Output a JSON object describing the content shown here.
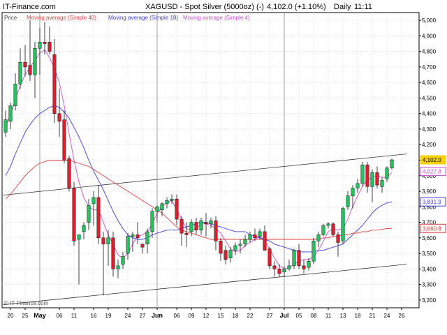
{
  "header": {
    "site": "IT-Finance.com",
    "title": "XAGUSD - Spot Silver (5000oz) (-)",
    "last": "4,102.0 (+1.10%)",
    "period": "Daily",
    "time": "11:11"
  },
  "watermark": "© IT-Finance.com",
  "colors": {
    "up": "#22c55e",
    "down": "#e11d2e",
    "ma40": "#e04040",
    "ma18": "#3b3bdc",
    "ma4": "#d04bd0",
    "trend": "#333333",
    "grid": "#c8c8c8",
    "last_box": "#f5d200",
    "border": "#000000"
  },
  "chart_data": {
    "type": "candlestick",
    "title": "XAGUSD - Spot Silver (5000oz) (-)",
    "legend": [
      {
        "key": "price",
        "label": "Price"
      },
      {
        "key": "ma40",
        "label": "Moving average (Simple 40)"
      },
      {
        "key": "ma18",
        "label": "Moving average (Simple 18)"
      },
      {
        "key": "ma4",
        "label": "Moving average (Simple 4)"
      }
    ],
    "ylim": [
      3150,
      5050
    ],
    "y_ticks": [
      3200,
      3300,
      3400,
      3500,
      3600,
      3700,
      3800,
      3900,
      4000,
      4100,
      4200,
      4300,
      4400,
      4500,
      4600,
      4700,
      4800,
      4900,
      5000
    ],
    "y_tick_labels": [
      "3,200",
      "3,300",
      "3,400",
      "3,500",
      "3,600",
      "3,700",
      "3,800",
      "3,900",
      "4,000",
      "4,100",
      "4,200",
      "4,300",
      "4,400",
      "4,500",
      "4,600",
      "4,700",
      "4,800",
      "4,900",
      "5,000"
    ],
    "x_labels": [
      {
        "i": 1,
        "text": "20"
      },
      {
        "i": 4,
        "text": "25"
      },
      {
        "i": 7,
        "text": "May"
      },
      {
        "i": 11,
        "text": "06"
      },
      {
        "i": 14,
        "text": "11"
      },
      {
        "i": 18,
        "text": "16"
      },
      {
        "i": 21,
        "text": "19"
      },
      {
        "i": 25,
        "text": "24"
      },
      {
        "i": 28,
        "text": "27"
      },
      {
        "i": 31,
        "text": "Jun"
      },
      {
        "i": 35,
        "text": "06"
      },
      {
        "i": 38,
        "text": "09"
      },
      {
        "i": 41,
        "text": "12"
      },
      {
        "i": 44,
        "text": "15"
      },
      {
        "i": 47,
        "text": "18"
      },
      {
        "i": 50,
        "text": "22"
      },
      {
        "i": 54,
        "text": "27"
      },
      {
        "i": 57,
        "text": "Jul"
      },
      {
        "i": 60,
        "text": "05"
      },
      {
        "i": 63,
        "text": "08"
      },
      {
        "i": 66,
        "text": "11"
      },
      {
        "i": 69,
        "text": "13"
      },
      {
        "i": 72,
        "text": "18"
      },
      {
        "i": 75,
        "text": "21"
      },
      {
        "i": 78,
        "text": "24"
      },
      {
        "i": 81,
        "text": "26"
      }
    ],
    "month_separators": [
      7,
      31,
      57
    ],
    "candles": [
      {
        "o": 4280,
        "h": 4420,
        "l": 4250,
        "c": 4360
      },
      {
        "o": 4350,
        "h": 4470,
        "l": 4300,
        "c": 4450
      },
      {
        "o": 4450,
        "h": 4660,
        "l": 4420,
        "c": 4590
      },
      {
        "o": 4590,
        "h": 4820,
        "l": 4560,
        "c": 4730
      },
      {
        "o": 4730,
        "h": 4840,
        "l": 4640,
        "c": 4700
      },
      {
        "o": 4710,
        "h": 5000,
        "l": 4610,
        "c": 4650
      },
      {
        "o": 4650,
        "h": 4860,
        "l": 4500,
        "c": 4820
      },
      {
        "o": 4820,
        "h": 4950,
        "l": 4650,
        "c": 4860
      },
      {
        "o": 4860,
        "h": 4990,
        "l": 4780,
        "c": 4850
      },
      {
        "o": 4860,
        "h": 4960,
        "l": 4780,
        "c": 4800
      },
      {
        "o": 4780,
        "h": 4880,
        "l": 4340,
        "c": 4400
      },
      {
        "o": 4400,
        "h": 4560,
        "l": 4250,
        "c": 4350
      },
      {
        "o": 4360,
        "h": 4420,
        "l": 4080,
        "c": 4100
      },
      {
        "o": 4110,
        "h": 4130,
        "l": 3900,
        "c": 3920
      },
      {
        "o": 3920,
        "h": 3960,
        "l": 3550,
        "c": 3580
      },
      {
        "o": 3590,
        "h": 3620,
        "l": 3300,
        "c": 3620
      },
      {
        "o": 3640,
        "h": 3700,
        "l": 3590,
        "c": 3680
      },
      {
        "o": 3700,
        "h": 3850,
        "l": 3650,
        "c": 3810
      },
      {
        "o": 3820,
        "h": 3900,
        "l": 3680,
        "c": 3860
      },
      {
        "o": 3860,
        "h": 3940,
        "l": 3560,
        "c": 3600
      },
      {
        "o": 3600,
        "h": 3640,
        "l": 3230,
        "c": 3560
      },
      {
        "o": 3560,
        "h": 3650,
        "l": 3420,
        "c": 3600
      },
      {
        "o": 3600,
        "h": 3640,
        "l": 3350,
        "c": 3400
      },
      {
        "o": 3400,
        "h": 3460,
        "l": 3340,
        "c": 3420
      },
      {
        "o": 3430,
        "h": 3510,
        "l": 3400,
        "c": 3480
      },
      {
        "o": 3500,
        "h": 3630,
        "l": 3460,
        "c": 3610
      },
      {
        "o": 3610,
        "h": 3640,
        "l": 3510,
        "c": 3620
      },
      {
        "o": 3620,
        "h": 3700,
        "l": 3560,
        "c": 3600
      },
      {
        "o": 3560,
        "h": 3560,
        "l": 3500,
        "c": 3540
      },
      {
        "o": 3560,
        "h": 3660,
        "l": 3500,
        "c": 3640
      },
      {
        "o": 3640,
        "h": 3790,
        "l": 3600,
        "c": 3770
      },
      {
        "o": 3770,
        "h": 3810,
        "l": 3700,
        "c": 3800
      },
      {
        "o": 3780,
        "h": 3830,
        "l": 3740,
        "c": 3820
      },
      {
        "o": 3820,
        "h": 3860,
        "l": 3790,
        "c": 3840
      },
      {
        "o": 3840,
        "h": 3880,
        "l": 3820,
        "c": 3850
      },
      {
        "o": 3850,
        "h": 3880,
        "l": 3680,
        "c": 3720
      },
      {
        "o": 3720,
        "h": 3740,
        "l": 3550,
        "c": 3630
      },
      {
        "o": 3630,
        "h": 3700,
        "l": 3540,
        "c": 3620
      },
      {
        "o": 3640,
        "h": 3720,
        "l": 3610,
        "c": 3700
      },
      {
        "o": 3700,
        "h": 3730,
        "l": 3620,
        "c": 3650
      },
      {
        "o": 3650,
        "h": 3730,
        "l": 3620,
        "c": 3710
      },
      {
        "o": 3700,
        "h": 3760,
        "l": 3610,
        "c": 3690
      },
      {
        "o": 3690,
        "h": 3730,
        "l": 3660,
        "c": 3710
      },
      {
        "o": 3710,
        "h": 3740,
        "l": 3520,
        "c": 3580
      },
      {
        "o": 3580,
        "h": 3600,
        "l": 3450,
        "c": 3500
      },
      {
        "o": 3520,
        "h": 3550,
        "l": 3430,
        "c": 3460
      },
      {
        "o": 3470,
        "h": 3540,
        "l": 3440,
        "c": 3520
      },
      {
        "o": 3520,
        "h": 3570,
        "l": 3490,
        "c": 3550
      },
      {
        "o": 3550,
        "h": 3590,
        "l": 3500,
        "c": 3560
      },
      {
        "o": 3560,
        "h": 3620,
        "l": 3540,
        "c": 3590
      },
      {
        "o": 3590,
        "h": 3640,
        "l": 3570,
        "c": 3620
      },
      {
        "o": 3620,
        "h": 3660,
        "l": 3580,
        "c": 3600
      },
      {
        "o": 3610,
        "h": 3660,
        "l": 3590,
        "c": 3640
      },
      {
        "o": 3640,
        "h": 3680,
        "l": 3520,
        "c": 3520
      },
      {
        "o": 3530,
        "h": 3540,
        "l": 3400,
        "c": 3420
      },
      {
        "o": 3420,
        "h": 3450,
        "l": 3350,
        "c": 3400
      },
      {
        "o": 3400,
        "h": 3430,
        "l": 3350,
        "c": 3370
      },
      {
        "o": 3380,
        "h": 3420,
        "l": 3350,
        "c": 3400
      },
      {
        "o": 3400,
        "h": 3460,
        "l": 3390,
        "c": 3420
      },
      {
        "o": 3420,
        "h": 3530,
        "l": 3400,
        "c": 3520
      },
      {
        "o": 3520,
        "h": 3560,
        "l": 3400,
        "c": 3420
      },
      {
        "o": 3420,
        "h": 3460,
        "l": 3370,
        "c": 3400
      },
      {
        "o": 3410,
        "h": 3470,
        "l": 3390,
        "c": 3450
      },
      {
        "o": 3450,
        "h": 3600,
        "l": 3430,
        "c": 3580
      },
      {
        "o": 3580,
        "h": 3640,
        "l": 3540,
        "c": 3620
      },
      {
        "o": 3620,
        "h": 3690,
        "l": 3610,
        "c": 3680
      },
      {
        "o": 3680,
        "h": 3700,
        "l": 3660,
        "c": 3690
      },
      {
        "o": 3690,
        "h": 3700,
        "l": 3610,
        "c": 3620
      },
      {
        "o": 3620,
        "h": 3640,
        "l": 3480,
        "c": 3570
      },
      {
        "o": 3580,
        "h": 3800,
        "l": 3560,
        "c": 3790
      },
      {
        "o": 3800,
        "h": 3900,
        "l": 3780,
        "c": 3870
      },
      {
        "o": 3870,
        "h": 3940,
        "l": 3790,
        "c": 3920
      },
      {
        "o": 3920,
        "h": 3980,
        "l": 3890,
        "c": 3950
      },
      {
        "o": 3950,
        "h": 4090,
        "l": 3930,
        "c": 4070
      },
      {
        "o": 4070,
        "h": 4090,
        "l": 3890,
        "c": 3930
      },
      {
        "o": 3930,
        "h": 4040,
        "l": 3830,
        "c": 4020
      },
      {
        "o": 4020,
        "h": 4060,
        "l": 3920,
        "c": 3940
      },
      {
        "o": 3930,
        "h": 3990,
        "l": 3890,
        "c": 3970
      },
      {
        "o": 3980,
        "h": 4060,
        "l": 3960,
        "c": 4050
      },
      {
        "o": 4050,
        "h": 4110,
        "l": 4040,
        "c": 4102
      }
    ],
    "series": [
      {
        "key": "ma4",
        "values": [
          4320,
          4390,
          4490,
          4580,
          4650,
          4700,
          4740,
          4790,
          4810,
          4760,
          4690,
          4600,
          4450,
          4270,
          4100,
          3960,
          3860,
          3800,
          3780,
          3780,
          3700,
          3620,
          3560,
          3490,
          3470,
          3500,
          3560,
          3610,
          3620,
          3640,
          3690,
          3760,
          3800,
          3830,
          3840,
          3780,
          3720,
          3660,
          3650,
          3660,
          3690,
          3690,
          3680,
          3660,
          3630,
          3580,
          3530,
          3510,
          3520,
          3550,
          3570,
          3590,
          3610,
          3580,
          3530,
          3470,
          3420,
          3400,
          3410,
          3430,
          3450,
          3460,
          3460,
          3480,
          3520,
          3580,
          3640,
          3660,
          3650,
          3660,
          3720,
          3800,
          3870,
          3930,
          3970,
          3990,
          4000,
          3990,
          3990,
          4020
        ]
      },
      {
        "key": "ma18",
        "values": [
          4000,
          4060,
          4140,
          4210,
          4280,
          4330,
          4370,
          4400,
          4420,
          4440,
          4450,
          4440,
          4410,
          4370,
          4310,
          4250,
          4180,
          4100,
          4030,
          3970,
          3910,
          3840,
          3770,
          3710,
          3660,
          3620,
          3600,
          3590,
          3590,
          3600,
          3620,
          3630,
          3640,
          3650,
          3650,
          3650,
          3660,
          3670,
          3680,
          3690,
          3700,
          3700,
          3690,
          3680,
          3670,
          3660,
          3650,
          3640,
          3640,
          3640,
          3620,
          3610,
          3600,
          3590,
          3580,
          3560,
          3550,
          3540,
          3530,
          3520,
          3510,
          3510,
          3510,
          3510,
          3520,
          3520,
          3530,
          3540,
          3550,
          3560,
          3590,
          3620,
          3650,
          3680,
          3720,
          3760,
          3790,
          3810,
          3825,
          3832
        ]
      },
      {
        "key": "ma40",
        "values": [
          3850,
          3880,
          3920,
          3960,
          4000,
          4030,
          4060,
          4080,
          4090,
          4100,
          4100,
          4100,
          4100,
          4100,
          4090,
          4080,
          4070,
          4060,
          4040,
          4020,
          4000,
          3980,
          3960,
          3940,
          3920,
          3900,
          3880,
          3860,
          3840,
          3820,
          3800,
          3780,
          3760,
          3730,
          3700,
          3670,
          3650,
          3640,
          3630,
          3620,
          3610,
          3600,
          3590,
          3590,
          3590,
          3590,
          3590,
          3590,
          3590,
          3590,
          3590,
          3590,
          3590,
          3590,
          3590,
          3590,
          3590,
          3590,
          3590,
          3590,
          3590,
          3590,
          3590,
          3590,
          3590,
          3600,
          3600,
          3610,
          3610,
          3620,
          3620,
          3630,
          3630,
          3640,
          3640,
          3650,
          3650,
          3655,
          3660,
          3661
        ]
      }
    ],
    "trendlines": [
      {
        "x0": -0.5,
        "y0": 3875,
        "x1": 82,
        "y1": 4140
      },
      {
        "x0": -0.5,
        "y0": 3170,
        "x1": 82,
        "y1": 3430
      }
    ],
    "last_values": [
      {
        "key": "price",
        "value": 4102.0,
        "text": "4,102.0"
      },
      {
        "key": "ma4",
        "value": 4027.8,
        "text": "4,027.8"
      },
      {
        "key": "ma18",
        "value": 3831.9,
        "text": "3,831.9"
      },
      {
        "key": "ma40",
        "value": 3660.8,
        "text": "3,660.8"
      }
    ]
  }
}
